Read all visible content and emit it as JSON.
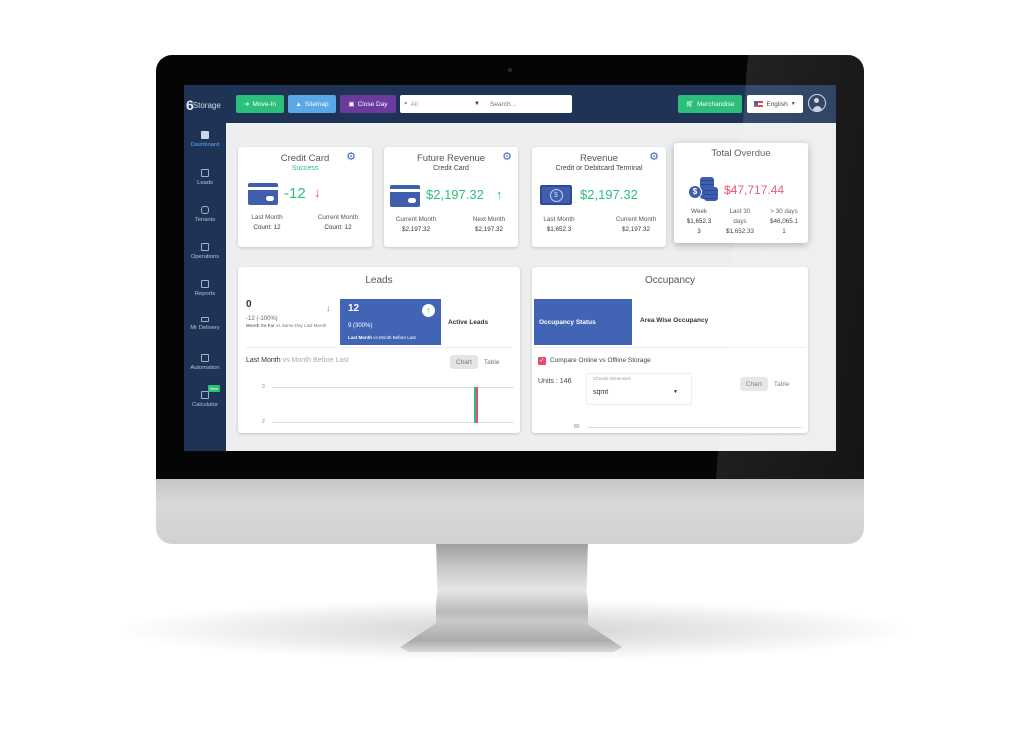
{
  "topbar": {
    "logo_text": "Storage",
    "logo_mark": "6",
    "buttons": {
      "move_in": "Move-In",
      "sitemap": "Sitemap",
      "close_day": "Close Day",
      "merchandise": "Merchandise"
    },
    "search": {
      "filter_value": "All",
      "placeholder": "Search..."
    },
    "language": "English",
    "colors": {
      "bar": "#1e3356",
      "green": "#2bbf7a",
      "blue": "#5aa8e6",
      "purple": "#6a3a9c"
    }
  },
  "sidebar": {
    "items": [
      {
        "label": "Dashboard",
        "icon": "dashboard-icon",
        "active": true
      },
      {
        "label": "Leads",
        "icon": "users-icon"
      },
      {
        "label": "Tenants",
        "icon": "database-icon"
      },
      {
        "label": "Operations",
        "icon": "clipboard-icon"
      },
      {
        "label": "Reports",
        "icon": "document-icon"
      },
      {
        "label": "Mr Delivery",
        "icon": "truck-icon"
      },
      {
        "label": "Automation",
        "icon": "checkbox-icon"
      },
      {
        "label": "Calculator",
        "icon": "calculator-icon",
        "badge": "New"
      }
    ]
  },
  "cards": {
    "credit_card": {
      "title": "Credit Card",
      "status": "Success",
      "value": "-12",
      "trend": "down",
      "left_label": "Last Month",
      "left_value": "Count: 12",
      "right_label": "Current Month",
      "right_value": "Count: 12"
    },
    "future_revenue": {
      "title": "Future Revenue",
      "subtitle": "Credit Card",
      "value": "$2,197.32",
      "trend": "up",
      "left_label": "Current Month",
      "left_value": "$2,197.32",
      "right_label": "Next Month",
      "right_value": "$2,197.32"
    },
    "revenue": {
      "title": "Revenue",
      "subtitle": "Credit or Debitcard Terminal",
      "value": "$2,197.32",
      "left_label": "Last Month",
      "left_value": "$1,652.3",
      "right_label": "Current Month",
      "right_value": "$2,197.32"
    },
    "total_overdue": {
      "title": "Total Overdue",
      "value": "$47,717.44",
      "cols": [
        {
          "label": "Week",
          "value_line1": "$1,652.3",
          "value_line2": "3"
        },
        {
          "label": "Last 30",
          "value_line1": "days",
          "value_line2": "$1,652.33"
        },
        {
          "label": "> 30 days",
          "value_line1": "$46,065.1",
          "value_line2": "1"
        }
      ]
    }
  },
  "leads": {
    "title": "Leads",
    "left": {
      "value": "0",
      "change": "-12 (-100%)",
      "desc_bold": "Month So Far",
      "desc_rest": "vs Same Day Last Month"
    },
    "right": {
      "value": "12",
      "change": "9 (300%)",
      "desc_bold": "Last Month",
      "desc_rest": "vs Month Before Last"
    },
    "active_label": "Active Leads",
    "compare_bold": "Last Month",
    "compare_rest": "vs Month Before Last",
    "toggle": {
      "chart": "Chart",
      "table": "Table",
      "selected": "Chart"
    },
    "chart_ticks": [
      "3",
      "2"
    ]
  },
  "occupancy": {
    "title": "Occupancy",
    "tabs": [
      "Occupancy Status",
      "Area Wise Occupancy"
    ],
    "active_tab": "Occupancy Status",
    "compare_label": "Compare Online vs Offline Storage",
    "compare_checked": true,
    "units_label": "Units : 146",
    "dimension_label": "Choose Dimension",
    "dimension_value": "sqmt",
    "toggle": {
      "chart": "Chart",
      "table": "Table",
      "selected": "Chart"
    },
    "chart_tick": "80"
  }
}
